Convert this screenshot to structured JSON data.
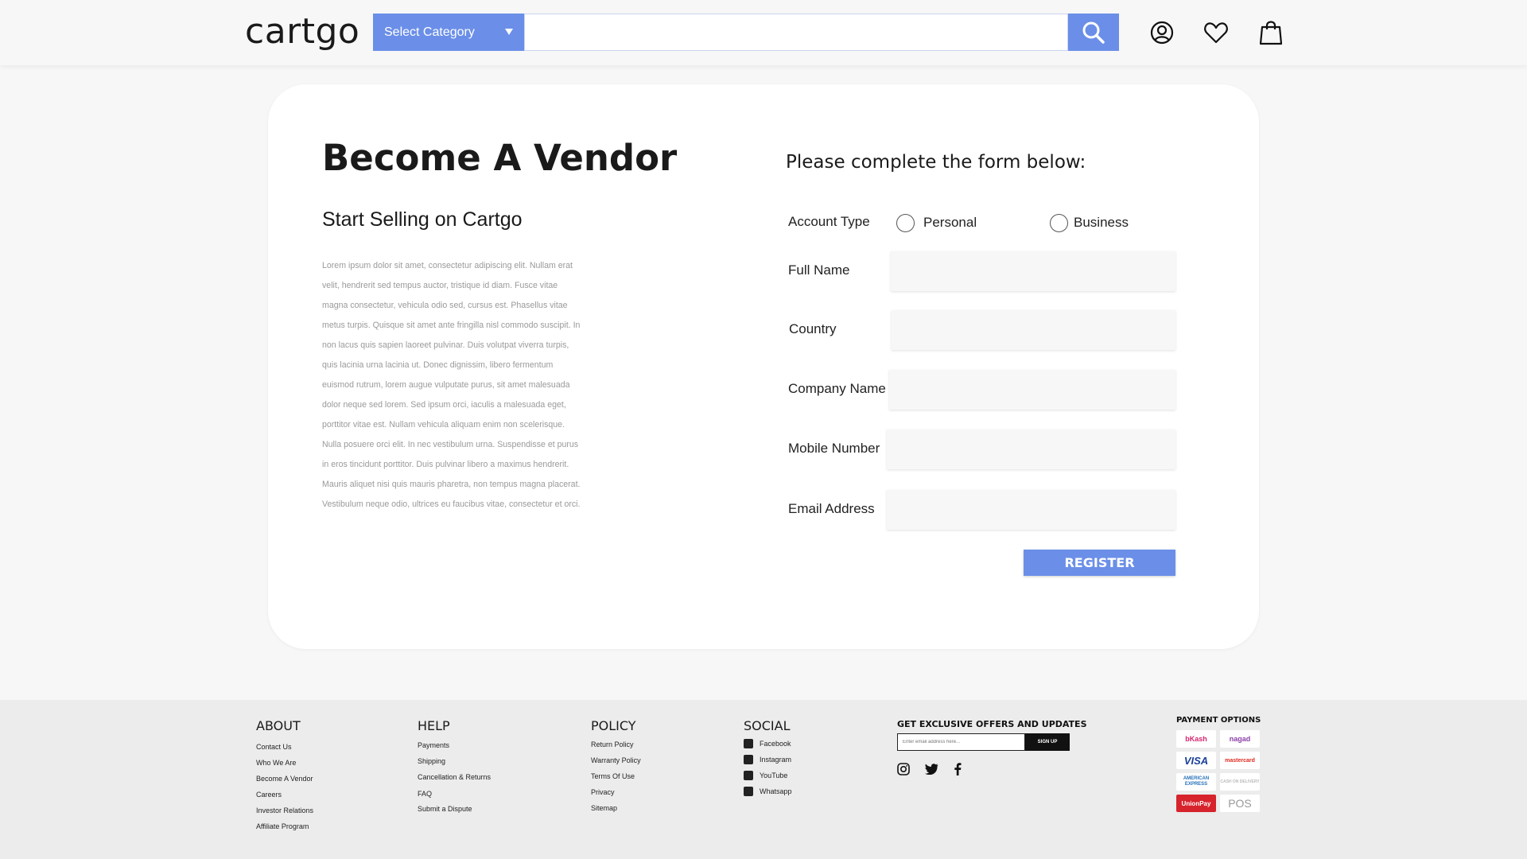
{
  "header": {
    "logo": "cartgo",
    "category_select": "Select Category",
    "search_placeholder": ""
  },
  "card": {
    "title": "Become A Vendor",
    "subtitle": "Start Selling on Cartgo",
    "lorem": "Lorem ipsum dolor sit amet, consectetur adipiscing elit. Nullam erat velit, hendrerit sed tempus auctor, tristique id diam. Fusce vitae magna consectetur, vehicula odio sed, cursus est. Phasellus vitae metus turpis. Quisque sit amet ante fringilla nisl commodo suscipit. In non lacus quis sapien laoreet pulvinar. Duis volutpat viverra turpis, quis lacinia urna lacinia ut. Donec dignissim, libero fermentum euismod rutrum, lorem augue vulputate purus, sit amet malesuada dolor neque sed lorem. Sed ipsum orci, iaculis a malesuada eget, porttitor vitae est. Nullam vehicula aliquam enim non scelerisque. Nulla posuere orci elit. In nec vestibulum urna. Suspendisse et purus in eros tincidunt porttitor. Duis pulvinar libero a maximus hendrerit. Mauris aliquet nisi quis mauris pharetra, non tempus magna placerat. Vestibulum neque odio, ultrices eu faucibus vitae, consectetur et orci."
  },
  "form": {
    "title": "Please complete the form below:",
    "account_type_label": "Account Type",
    "option_personal": "Personal",
    "option_business": "Business",
    "full_name_label": "Full Name",
    "country_label": "Country",
    "company_label": "Company Name",
    "mobile_label": "Mobile Number",
    "email_label": "Email Address",
    "register": "REGISTER"
  },
  "footer": {
    "about": {
      "heading": "ABOUT",
      "links": [
        "Contact Us",
        "Who We Are",
        "Become A Vendor",
        "Careers",
        "Investor Relations",
        "Affiliate Program"
      ]
    },
    "help": {
      "heading": "HELP",
      "links": [
        "Payments",
        "Shipping",
        "Cancellation & Returns",
        "FAQ",
        "Submit a Dispute"
      ]
    },
    "policy": {
      "heading": "POLICY",
      "links": [
        "Return Policy",
        "Warranty Policy",
        "Terms Of Use",
        "Privacy",
        "Sitemap"
      ]
    },
    "social": {
      "heading": "SOCIAL",
      "links": [
        "Facebook",
        "Instagram",
        "YouTube",
        "Whatsapp"
      ]
    },
    "offers_heading": "GET EXCLUSIVE OFFERS AND UPDATES",
    "email_placeholder": "Enter email address here...",
    "signup": "SIGN UP",
    "payment_heading": "PAYMENT OPTIONS",
    "payment_tiles": [
      "bKash",
      "nagad",
      "VISA",
      "mastercard",
      "AMERICAN EXPRESS",
      "CASH ON DELIVERY",
      "UnionPay",
      "POS"
    ]
  },
  "colors": {
    "accent": "#6b8fe8",
    "page_bg": "#f7f7f7",
    "footer_bg": "#ececec"
  }
}
